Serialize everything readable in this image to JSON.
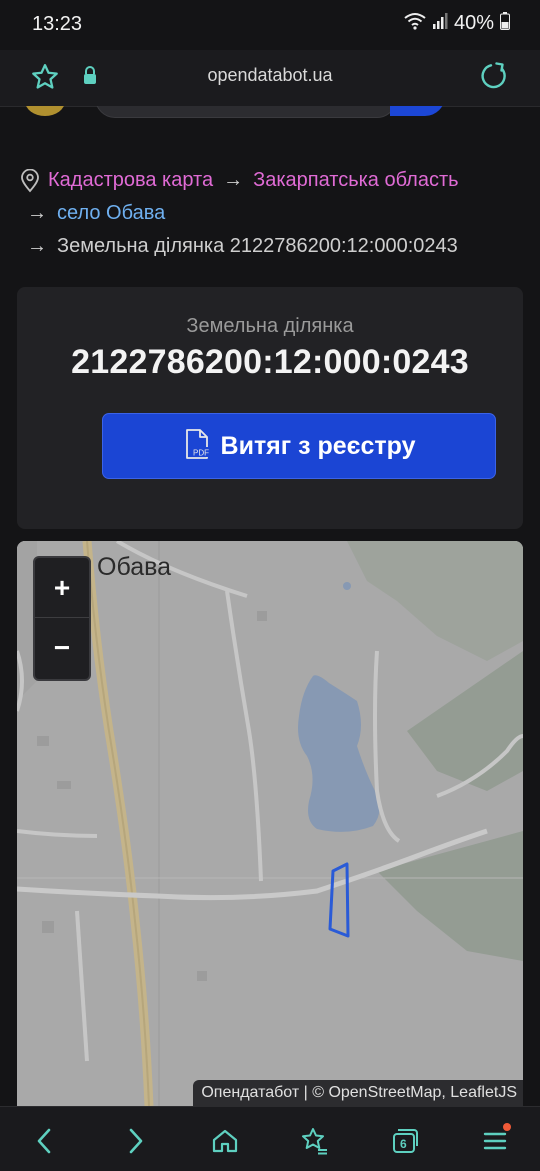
{
  "status_bar": {
    "time": "13:23",
    "battery": "40%"
  },
  "browser": {
    "url": "opendatabot.ua"
  },
  "breadcrumbs": {
    "items": [
      {
        "label": "Кадастрова карта"
      },
      {
        "label": "Закарпатська область"
      },
      {
        "label": "село Обава"
      },
      {
        "label": "Земельна ділянка 2122786200:12:000:0243"
      }
    ],
    "separator": "→"
  },
  "parcel_card": {
    "label": "Земельна ділянка",
    "cadastral_number": "2122786200:12:000:0243",
    "extract_button_label": "Витяг з реєстру",
    "pdf_icon_text": "PDF"
  },
  "map": {
    "place_label": "Обава",
    "zoom_in_label": "+",
    "zoom_out_label": "−",
    "attribution": "Опендатабот | © OpenStreetMap, LeafletJS",
    "parcel_color": "#2a5bd7"
  },
  "bottom_nav": {
    "tabs_count": "6",
    "items": [
      "back-icon",
      "forward-icon",
      "home-icon",
      "bookmarks-icon",
      "tabs-icon",
      "menu-icon"
    ]
  },
  "colors": {
    "accent": "#1b45d4",
    "breadcrumb_pink": "#e06bd5",
    "breadcrumb_blue": "#6fb0f0",
    "reload_icon": "#5ed0c0"
  }
}
